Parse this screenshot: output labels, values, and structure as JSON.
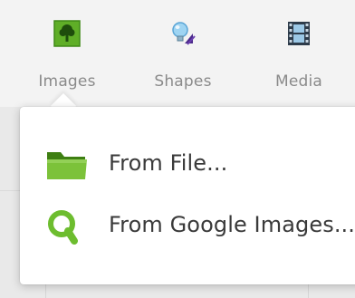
{
  "toolbar": {
    "items": [
      {
        "label": "Images",
        "icon": "tree-icon"
      },
      {
        "label": "Shapes",
        "icon": "lightbulb-shapes-icon"
      },
      {
        "label": "Media",
        "icon": "film-icon"
      }
    ]
  },
  "menu": {
    "items": [
      {
        "label": "From File...",
        "icon": "folder-icon"
      },
      {
        "label": "From Google Images...",
        "icon": "search-icon"
      }
    ]
  },
  "colors": {
    "accent_green": "#7cc23a",
    "folder_green": "#76b82a",
    "label_gray": "#8a8a8a",
    "menu_text": "#3a3a3a"
  }
}
